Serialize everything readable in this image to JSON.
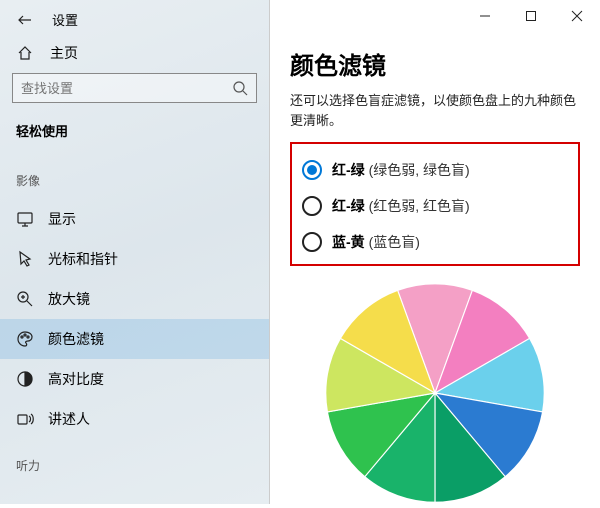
{
  "window": {
    "title": "设置",
    "home": "主页",
    "search_placeholder": "查找设置",
    "section": "轻松使用",
    "groups": {
      "vision": "影像",
      "hearing": "听力"
    },
    "nav": {
      "display": "显示",
      "cursor": "光标和指针",
      "magnifier": "放大镜",
      "colorfilters": "颜色滤镜",
      "highcontrast": "高对比度",
      "narrator": "讲述人"
    }
  },
  "main": {
    "title": "颜色滤镜",
    "desc": "还可以选择色盲症滤镜，以使颜色盘上的九种颜色更清晰。",
    "options": [
      {
        "label": "红-绿",
        "note": "(绿色弱, 绿色盲)",
        "checked": true
      },
      {
        "label": "红-绿",
        "note": "(红色弱, 红色盲)",
        "checked": false
      },
      {
        "label": "蓝-黄",
        "note": "(蓝色盲)",
        "checked": false
      }
    ]
  },
  "chart_data": {
    "type": "pie",
    "title": "",
    "categories": [
      "slice1",
      "slice2",
      "slice3",
      "slice4",
      "slice5",
      "slice6",
      "slice7",
      "slice8",
      "slice9"
    ],
    "values": [
      1,
      1,
      1,
      1,
      1,
      1,
      1,
      1,
      1
    ],
    "colors": [
      "#f4a0c6",
      "#f37fc0",
      "#6bd0ec",
      "#2b7bd1",
      "#0a9e66",
      "#19b36a",
      "#2fc24e",
      "#cde660",
      "#f5dd4b"
    ]
  }
}
